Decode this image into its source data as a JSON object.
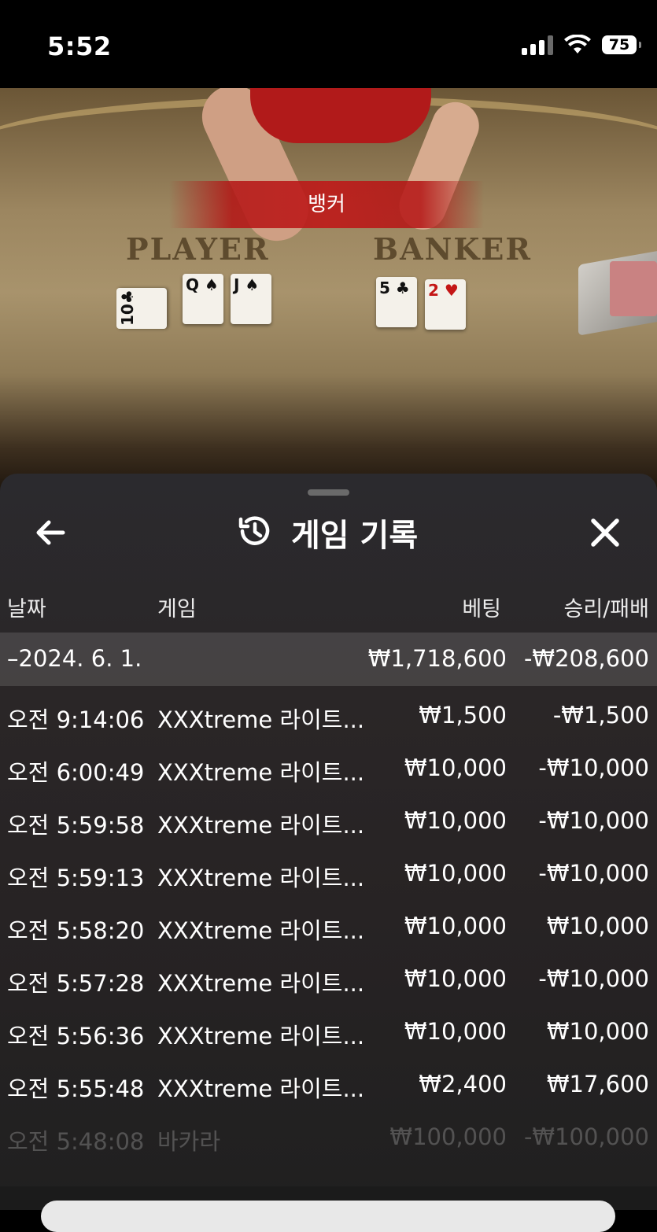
{
  "status_bar": {
    "time": "5:52",
    "battery": "75",
    "icons": [
      "signal-icon",
      "wifi-icon",
      "battery-icon"
    ]
  },
  "video": {
    "result_banner": "뱅커",
    "player_label": "PLAYER",
    "banker_label": "BANKER",
    "player_cards": [
      {
        "rank": "10",
        "suit": "♣"
      },
      {
        "rank": "Q",
        "suit": "♠"
      },
      {
        "rank": "J",
        "suit": "♠"
      }
    ],
    "banker_cards": [
      {
        "rank": "5",
        "suit": "♣"
      },
      {
        "rank": "2",
        "suit": "♥"
      }
    ]
  },
  "sheet": {
    "title": "게임 기록",
    "icons": {
      "back": "back-arrow-icon",
      "history": "history-icon",
      "close": "close-icon"
    },
    "columns": {
      "date": "날짜",
      "game": "게임",
      "bet": "베팅",
      "result": "승리/패배"
    },
    "date_group": {
      "date": "–2024. 6. 1.",
      "bet_total": "₩1,718,600",
      "result_total": "-₩208,600"
    },
    "rows": [
      {
        "time": "오전 9:14:06",
        "game": "XXXtreme 라이트...",
        "bet": "₩1,500",
        "result": "-₩1,500"
      },
      {
        "time": "오전 6:00:49",
        "game": "XXXtreme 라이트...",
        "bet": "₩10,000",
        "result": "-₩10,000"
      },
      {
        "time": "오전 5:59:58",
        "game": "XXXtreme 라이트...",
        "bet": "₩10,000",
        "result": "-₩10,000"
      },
      {
        "time": "오전 5:59:13",
        "game": "XXXtreme 라이트...",
        "bet": "₩10,000",
        "result": "-₩10,000"
      },
      {
        "time": "오전 5:58:20",
        "game": "XXXtreme 라이트...",
        "bet": "₩10,000",
        "result": "₩10,000"
      },
      {
        "time": "오전 5:57:28",
        "game": "XXXtreme 라이트...",
        "bet": "₩10,000",
        "result": "-₩10,000"
      },
      {
        "time": "오전 5:56:36",
        "game": "XXXtreme 라이트...",
        "bet": "₩10,000",
        "result": "₩10,000"
      },
      {
        "time": "오전 5:55:48",
        "game": "XXXtreme 라이트...",
        "bet": "₩2,400",
        "result": "₩17,600"
      },
      {
        "time": "오전 5:48:08",
        "game": "바카라",
        "bet": "₩100,000",
        "result": "-₩100,000"
      }
    ]
  }
}
